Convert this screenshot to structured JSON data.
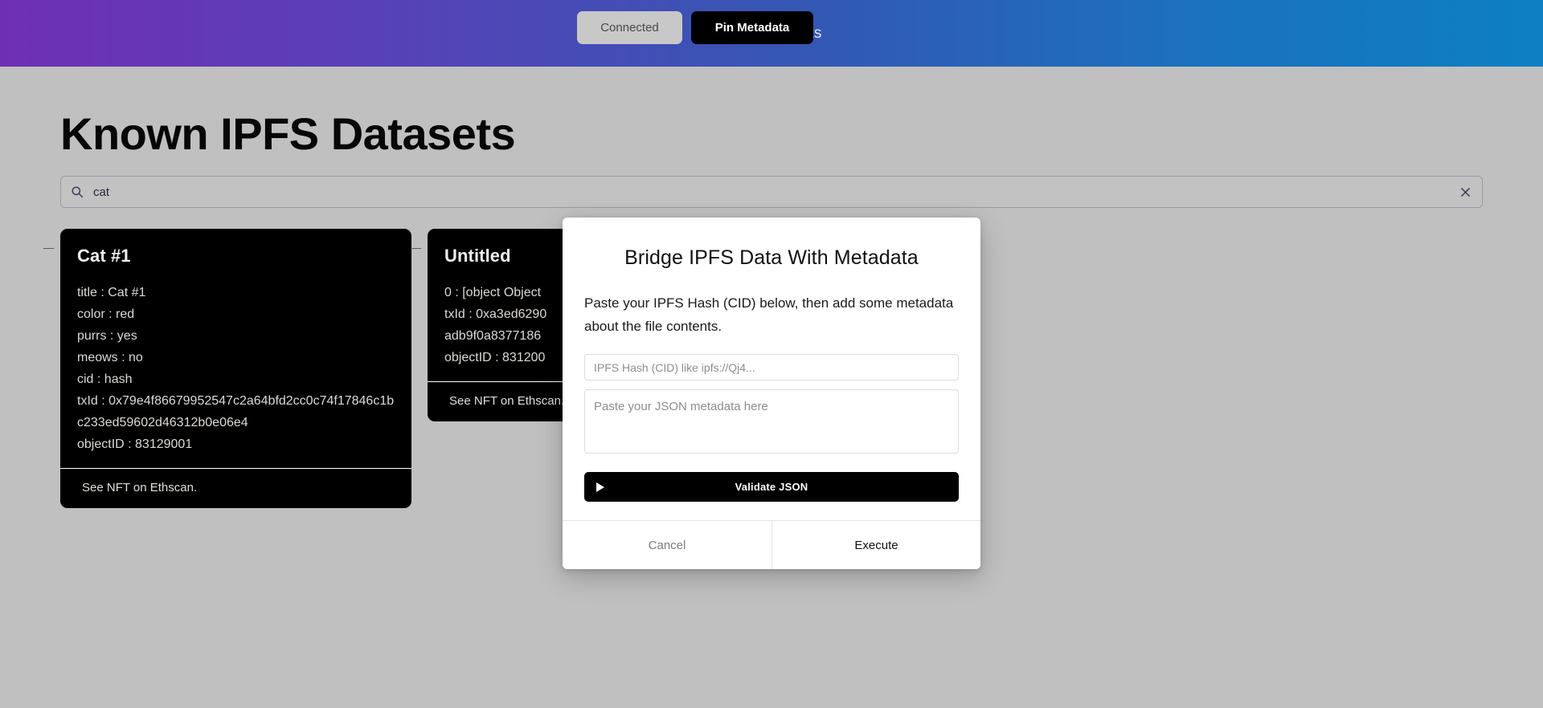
{
  "header": {
    "title": "IPFS Datasets",
    "connected_label": "Connected",
    "pin_label": "Pin Metadata",
    "gradient_start": "#6f2fb5",
    "gradient_end": "#0d80c2"
  },
  "page": {
    "title": "Known IPFS Datasets"
  },
  "search": {
    "value": "cat",
    "placeholder": "",
    "icon": "search-icon",
    "clear_icon": "close-icon"
  },
  "cards": [
    {
      "title": "Cat #1",
      "lines": [
        "title : Cat #1",
        "color : red",
        "purrs : yes",
        "meows : no",
        "cid : hash",
        "txId : 0x79e4f86679952547c2a64bfd2cc0c74f17846c1bc233ed59602d46312b0e06e4",
        "objectID : 83129001"
      ],
      "footer": "See NFT on Ethscan."
    },
    {
      "title": "Untitled",
      "lines": [
        "0 : [object Object",
        "txId : 0xa3ed6290",
        "adb9f0a8377186",
        "objectID : 831200"
      ],
      "footer": "See NFT on Ethscan."
    }
  ],
  "modal": {
    "title": "Bridge IPFS Data With Metadata",
    "description": "Paste your IPFS Hash (CID) below, then add some metadata about the file contents.",
    "cid_placeholder": "IPFS Hash (CID) like ipfs://Qj4...",
    "cid_value": "",
    "json_placeholder": "Paste your JSON metadata here",
    "json_value": "",
    "validate_label": "Validate JSON",
    "validate_icon": "play-icon",
    "cancel_label": "Cancel",
    "execute_label": "Execute"
  }
}
